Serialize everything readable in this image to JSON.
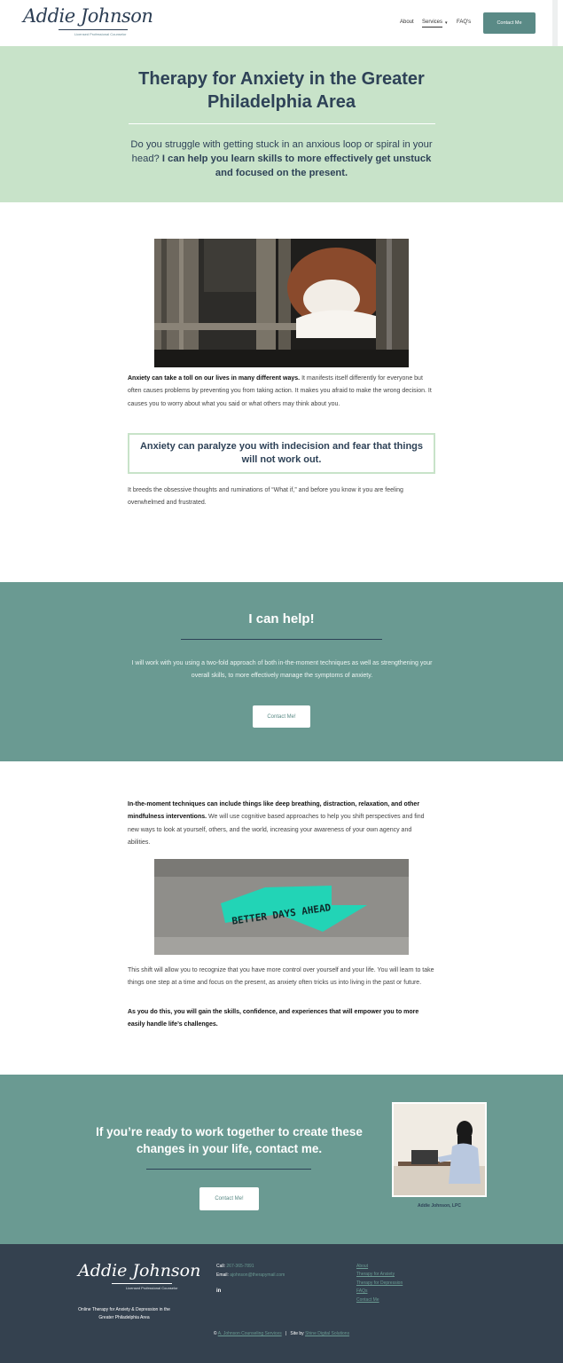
{
  "header": {
    "logo_script": "Addie Johnson",
    "logo_sub": "Licensed Professional Counselor",
    "nav": {
      "about": "About",
      "services": "Services",
      "services_caret": "▾",
      "faqs": "FAQ's"
    },
    "contact_button": "Contact Me"
  },
  "hero": {
    "title": "Therapy for Anxiety in the Greater Philadelphia Area",
    "lead_plain": "Do you struggle with getting stuck in an anxious loop or spiral in your head?",
    "lead_bold": "I can help you learn skills to more effectively get unstuck and focused on the present."
  },
  "section1": {
    "para1_bold": "Anxiety can take a toll on our lives in many different ways.",
    "para1_rest": " It manifests itself differently for everyone but often causes problems by preventing you from taking action.  It makes you afraid to make the wrong decision.  It causes you to worry about what you said or what others may think about you.",
    "quote": "Anxiety can paralyze you with indecision and fear that things will not work out.",
    "para2": "It breeds the obsessive thoughts and ruminations of “What if,” and before you know it you are feeling overwhelmed and frustrated."
  },
  "help": {
    "title": "I can help!",
    "text": "I will work with you using a two-fold approach of both in-the-moment techniques as well as strengthening your overall skills, to more effectively manage the symptoms of anxiety.",
    "button": "Contact Me!"
  },
  "section2": {
    "para1_bold": "In-the-moment techniques can include things like deep breathing, distraction, relaxation, and other mindfulness interventions.",
    "para1_rest": "  We will use cognitive based approaches to help you shift perspectives and find new ways to look at yourself, others, and the world, increasing your awareness of your own agency and abilities.",
    "sign_text": "BETTER DAYS AHEAD",
    "para2": "This shift will allow you to recognize that you have more control over yourself and your life.  You will learn to take things one step at a time and focus on the present, as anxiety often tricks us into living in the past or future.",
    "para3_bold": "As you do this, you will gain the skills, confidence, and experiences that will empower you to more easily handle life’s challenges."
  },
  "cta": {
    "title": "If you’re ready to work together to create these changes in your life, contact me.",
    "button": "Contact Me!",
    "portrait_caption": "Addie Johnson, LPC"
  },
  "footer": {
    "logo_script": "Addie Johnson",
    "logo_sub": "Licensed Professional Counselor",
    "tagline": "Online Therapy for Anxiety & Depression in the Greater Philadelphia Area",
    "call_label": "Call: ",
    "call_value": "267-365-7891",
    "email_label": "Email: ",
    "email_value": "ajohnson@therapymail.com",
    "linkedin": "in",
    "links": [
      "About",
      "Therapy for Anxiety",
      "Therapy for Depression",
      "FAQs",
      "Contact Me"
    ],
    "copyright_prefix": "© ",
    "copyright_link": "A. Johnson Counseling Services",
    "separator": "|",
    "site_by_label": "Site by ",
    "site_by_link": "Shine Digital Solutions"
  },
  "colors": {
    "mint": "#c8e3c9",
    "teal": "#6a9a92",
    "navy": "#2e4257",
    "footer": "#34414f"
  }
}
